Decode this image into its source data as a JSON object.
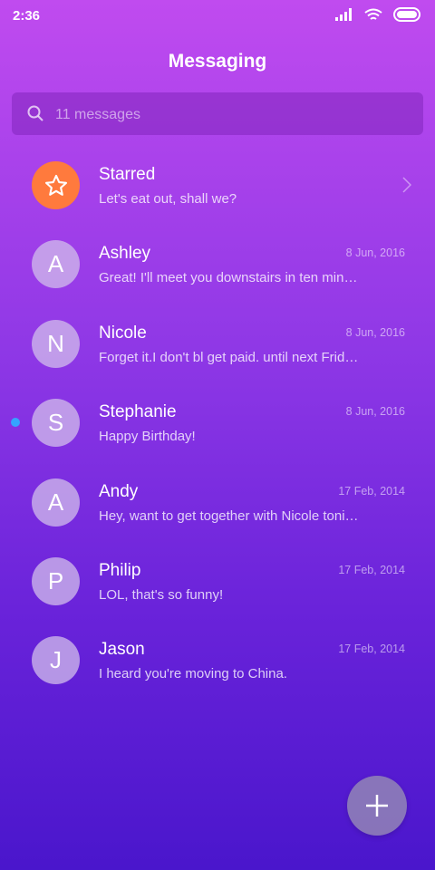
{
  "status_bar": {
    "time": "2:36"
  },
  "header": {
    "title": "Messaging"
  },
  "search": {
    "placeholder": "11 messages"
  },
  "conversations": [
    {
      "name": "Starred",
      "preview": "Let's eat out, shall we?",
      "date": "",
      "initial": "",
      "type": "starred"
    },
    {
      "name": "Ashley",
      "preview": "Great! I'll meet you downstairs in ten minutes.",
      "date": "8 Jun, 2016",
      "initial": "A"
    },
    {
      "name": "Nicole",
      "preview": "Forget it.I don't bl get paid. until next Friday.",
      "date": "8 Jun, 2016",
      "initial": "N"
    },
    {
      "name": "Stephanie",
      "preview": "Happy Birthday!",
      "date": "8 Jun, 2016",
      "initial": "S",
      "unread": true
    },
    {
      "name": "Andy",
      "preview": "Hey, want to get together with Nicole tonight?",
      "date": "17 Feb, 2014",
      "initial": "A"
    },
    {
      "name": "Philip",
      "preview": "LOL, that's so funny!",
      "date": "17 Feb, 2014",
      "initial": "P"
    },
    {
      "name": "Jason",
      "preview": "I heard you're moving to China.",
      "date": "17 Feb, 2014",
      "initial": "J"
    }
  ],
  "colors": {
    "starred_accent": "#ff7a3d",
    "unread_dot": "#35a3ff"
  }
}
